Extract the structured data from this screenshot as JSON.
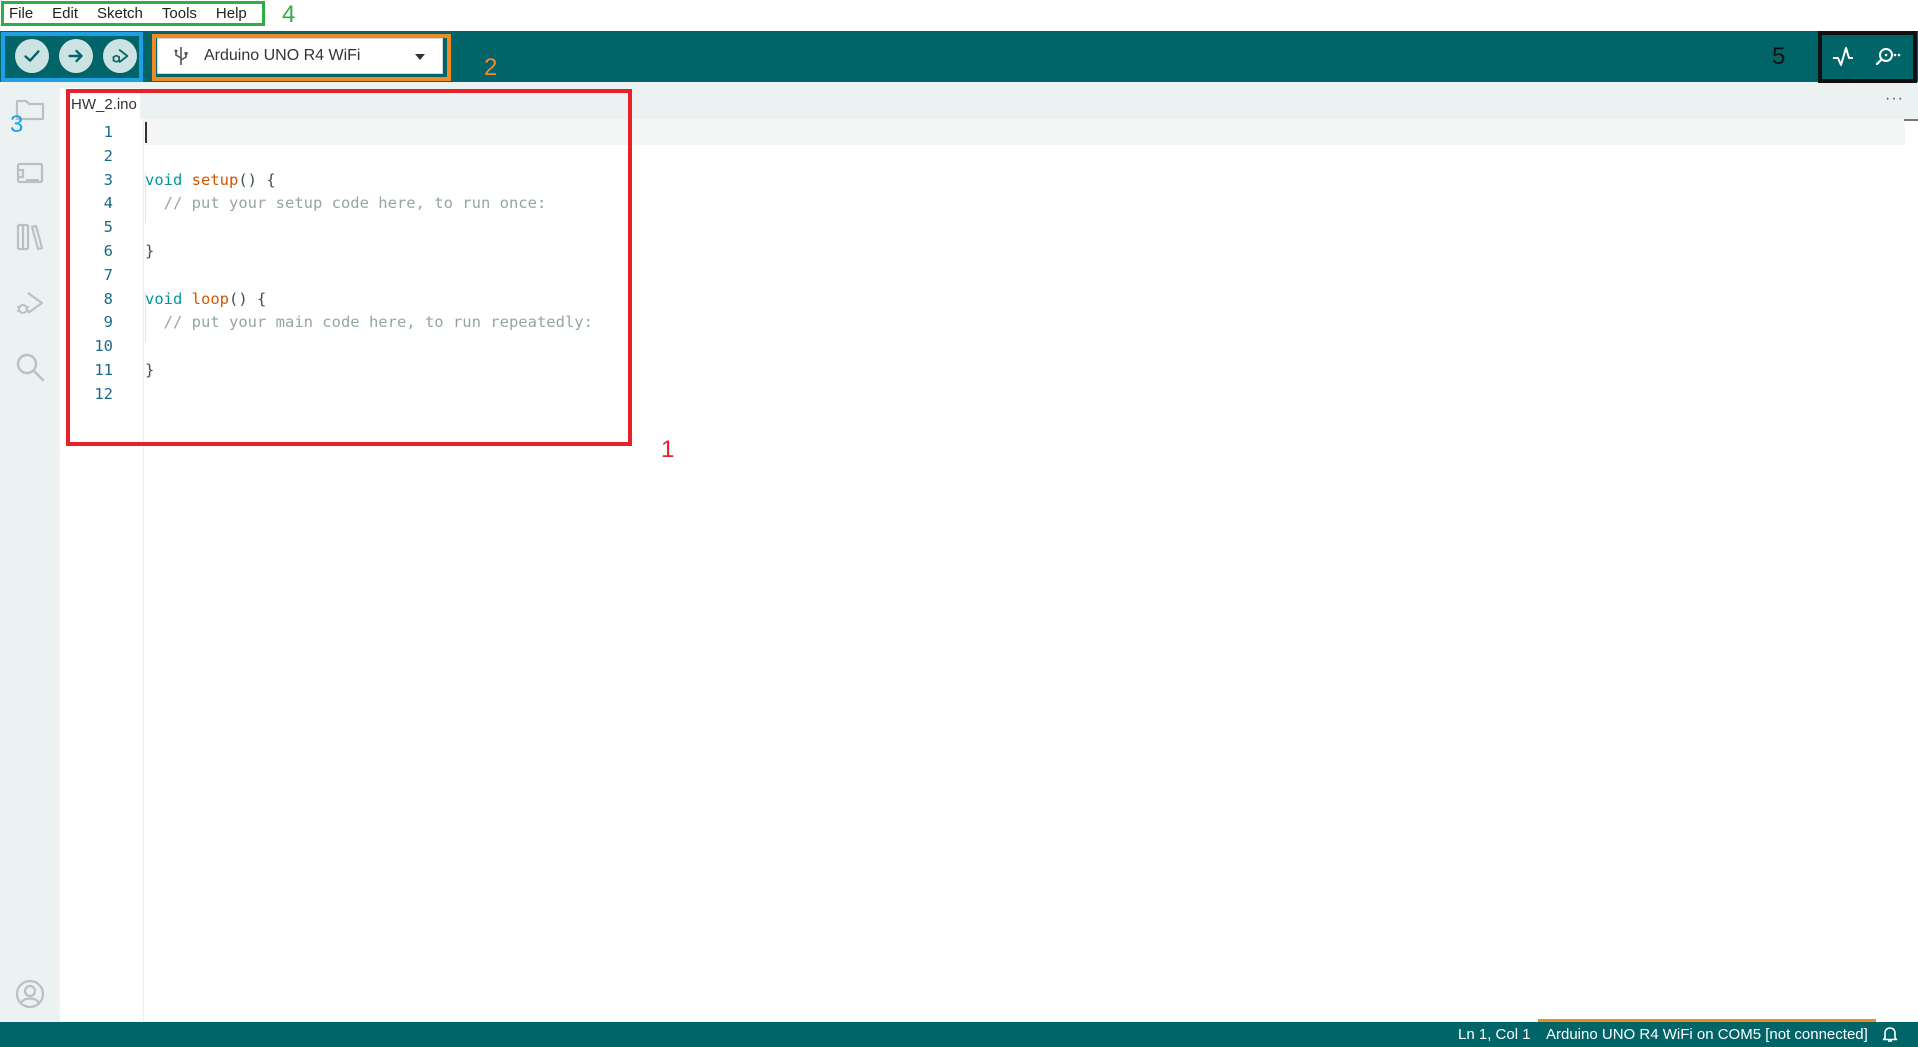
{
  "menu": {
    "items": [
      "File",
      "Edit",
      "Sketch",
      "Tools",
      "Help"
    ]
  },
  "toolbar": {
    "board_name": "Arduino UNO R4 WiFi",
    "verify_icon": "check-icon",
    "upload_icon": "arrow-right-icon",
    "debug_icon": "debug-icon",
    "plotter_icon": "serial-plotter-icon",
    "monitor_icon": "serial-monitor-icon"
  },
  "sidebar": {
    "icons": [
      "folder-icon",
      "board-manager-icon",
      "library-icon",
      "debug-icon",
      "search-icon",
      "account-icon"
    ]
  },
  "editor": {
    "tab_name": "HW_2.ino",
    "more_label": "···",
    "lines": [
      {
        "n": "1",
        "parts": []
      },
      {
        "n": "2",
        "parts": []
      },
      {
        "n": "3",
        "parts": [
          {
            "t": "void",
            "c": "kw"
          },
          {
            "t": " "
          },
          {
            "t": "setup",
            "c": "fn"
          },
          {
            "t": "() {"
          }
        ]
      },
      {
        "n": "4",
        "parts": [
          {
            "t": "  "
          },
          {
            "t": "// put your setup code here, to run once:",
            "c": "cm"
          }
        ]
      },
      {
        "n": "5",
        "parts": []
      },
      {
        "n": "6",
        "parts": [
          {
            "t": "}"
          }
        ]
      },
      {
        "n": "7",
        "parts": []
      },
      {
        "n": "8",
        "parts": [
          {
            "t": "void",
            "c": "kw"
          },
          {
            "t": " "
          },
          {
            "t": "loop",
            "c": "fn"
          },
          {
            "t": "() {"
          }
        ]
      },
      {
        "n": "9",
        "parts": [
          {
            "t": "  "
          },
          {
            "t": "// put your main code here, to run repeatedly:",
            "c": "cm"
          }
        ]
      },
      {
        "n": "10",
        "parts": []
      },
      {
        "n": "11",
        "parts": [
          {
            "t": "}"
          }
        ]
      },
      {
        "n": "12",
        "parts": []
      }
    ]
  },
  "status": {
    "position": "Ln 1, Col 1",
    "board": "Arduino UNO R4 WiFi on COM5 [not connected]"
  },
  "annotations": [
    {
      "label": "1",
      "color": "#e8202a"
    },
    {
      "label": "2",
      "color": "#f08a24"
    },
    {
      "label": "3",
      "color": "#1ea0e6"
    },
    {
      "label": "4",
      "color": "#2fae45"
    },
    {
      "label": "5",
      "color": "#111111"
    }
  ],
  "colors": {
    "teal": "#006468",
    "sidebar_bg": "#ecf1f1",
    "keyword": "#00979c",
    "function": "#d35400",
    "comment": "#95a5a6",
    "line_number": "#1a6b8a"
  }
}
